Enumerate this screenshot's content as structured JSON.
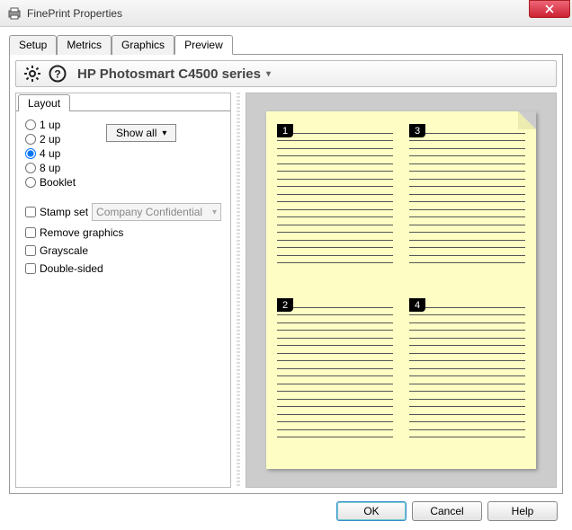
{
  "window": {
    "title": "FinePrint Properties"
  },
  "tabs": {
    "items": [
      "Setup",
      "Metrics",
      "Graphics",
      "Preview"
    ],
    "active_index": 3
  },
  "toolbar": {
    "printer": "HP Photosmart C4500 series"
  },
  "layout": {
    "tab_label": "Layout",
    "options": [
      "1 up",
      "2 up",
      "4 up",
      "8 up",
      "Booklet"
    ],
    "selected_index": 2,
    "show_all_label": "Show all",
    "stamp_set_label": "Stamp set",
    "stamp_set_value": "Company Confidential",
    "stamp_set_checked": false,
    "remove_graphics_label": "Remove graphics",
    "remove_graphics_checked": false,
    "grayscale_label": "Grayscale",
    "grayscale_checked": false,
    "double_sided_label": "Double-sided",
    "double_sided_checked": false
  },
  "preview": {
    "pages": [
      "1",
      "3",
      "2",
      "4"
    ]
  },
  "buttons": {
    "ok": "OK",
    "cancel": "Cancel",
    "help": "Help"
  }
}
